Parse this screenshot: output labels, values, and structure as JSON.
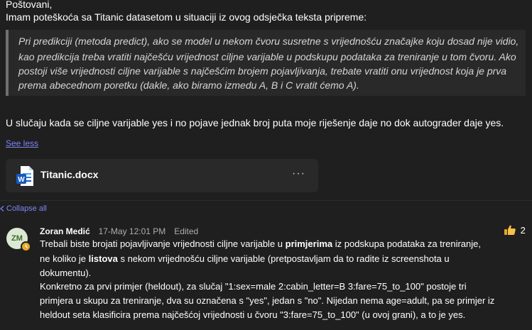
{
  "message": {
    "greeting": "Poštovani,",
    "intro": "Imam poteškoća sa Titanic datasetom u situaciji iz ovog odsječka teksta pripreme:",
    "quote_lines": [
      "Pri predikciji (metoda predict), ako se model u nekom čvoru susretne s vrijednošću značajke koju dosad nije vidio,",
      "kao predikcija treba vratiti najčešću vrijednost ciljne varijable u podskupu podataka za treniranje u tom čvoru. Ako",
      "postoji više vrijednosti ciljne varijable s najčešćim brojem pojavljivanja, trebate vratiti onu vrijednost koja je prva",
      "prema abecednom poretku (dakle, ako biramo izmedu A, B i C vratit ćemo A)."
    ],
    "body": "U slučaju kada se ciljne varijable yes i no pojave jednak broj puta moje riješenje daje no dok autograder daje yes.",
    "see_less": "See less"
  },
  "attachment": {
    "file_name": "Titanic.docx",
    "more": "···",
    "icon": "word-doc-icon"
  },
  "thread": {
    "collapse_all": "Collapse all"
  },
  "reply": {
    "avatar_initials": "ZM",
    "author": "Zoran Medić",
    "timestamp": "17-May 12:01 PM",
    "edited": "Edited",
    "reaction_icon": "thumbs-up",
    "reaction_count": "2",
    "lines": [
      [
        "Trebali biste brojati pojavljivanje vrijednosti ciljne varijable u ",
        "primjerima",
        " iz podskupa podataka za treniranje,"
      ],
      [
        "ne koliko je ",
        "listova",
        " s nekom vrijednošću ciljne varijable (pretpostavljam da to radite iz screenshota u"
      ],
      [
        "dokumentu).",
        "",
        ""
      ],
      [
        "Konkretno za prvi primjer (heldout), za slučaj \"1:sex=male 2:cabin_letter=B 3:fare=75_to_100\" postoje tri",
        "",
        ""
      ],
      [
        "primjera u skupu za treniranje, dva su označena s \"yes\", jedan s \"no\". Nijedan nema age=adult, pa se primjer iz",
        "",
        ""
      ],
      [
        "heldout seta klasificira prema najčešćoj vrijednosti u čvoru \"3:fare=75_to_100\" (u ovoj grani), a to je yes.",
        "",
        ""
      ]
    ]
  },
  "colors": {
    "background": "#1f1f1f",
    "link": "#7f85f5",
    "quote_bg": "#292929",
    "word_blue": "#185abd"
  }
}
